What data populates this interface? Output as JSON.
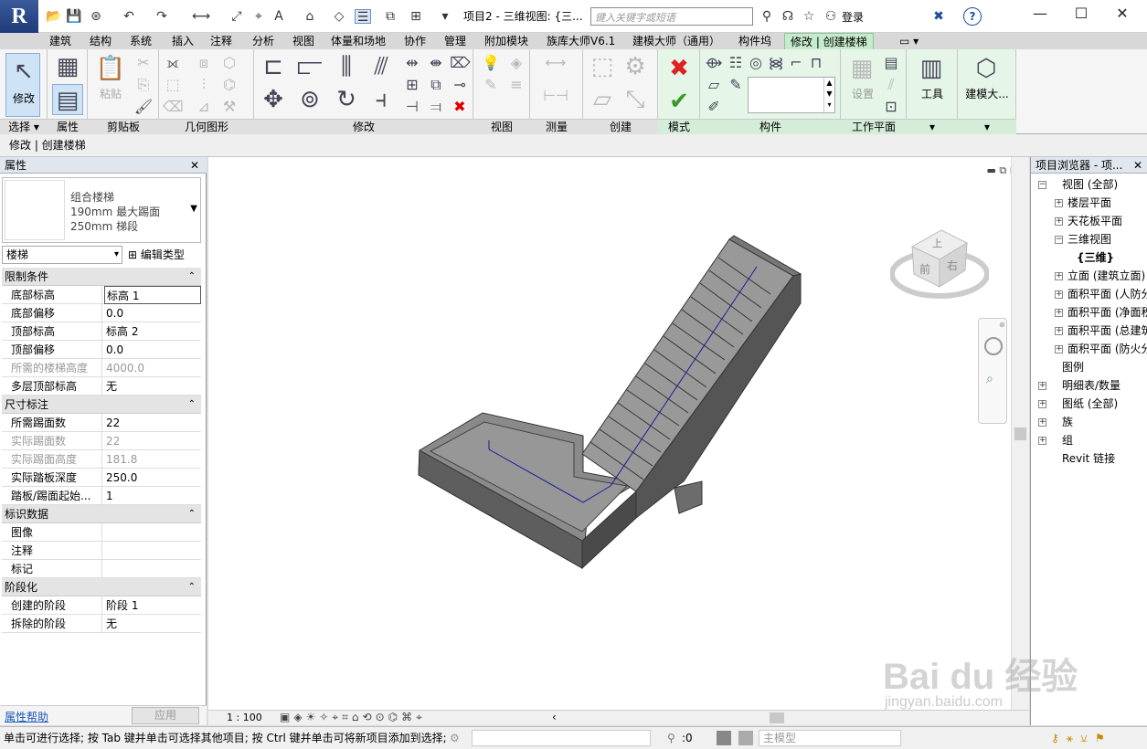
{
  "titlebar": {
    "logo": "R",
    "doc_title": "项目2 - 三维视图: {三...",
    "search_placeholder": "键入关键字或短语",
    "login": "登录",
    "help": "?",
    "min": "—",
    "max": "☐",
    "close": "✕"
  },
  "tabs": [
    "建筑",
    "结构",
    "系统",
    "插入",
    "注释",
    "分析",
    "视图",
    "体量和场地",
    "协作",
    "管理",
    "附加模块",
    "族库大师V6.1",
    "建模大师（通用）",
    "构件坞",
    "修改 | 创建楼梯"
  ],
  "ribbon": {
    "modify_label": "修改",
    "paste_label": "粘贴",
    "settings_label": "设置",
    "tools_label": "工具",
    "model_label": "建模大...",
    "panels": {
      "select": "选择 ▾",
      "properties": "属性",
      "clipboard": "剪贴板",
      "geometry": "几何图形",
      "modify": "修改",
      "view": "视图",
      "measure": "测量",
      "create": "创建",
      "mode": "模式",
      "component": "构件",
      "workplane": "工作平面"
    }
  },
  "context": "修改 | 创建楼梯",
  "properties": {
    "title": "属性",
    "type_line1": "组合楼梯",
    "type_line2": "190mm 最大踢面",
    "type_line3": "250mm 梯段",
    "filter": "楼梯",
    "edit_type": "编辑类型",
    "sections": [
      {
        "name": "限制条件",
        "rows": [
          {
            "k": "底部标高",
            "v": "标高 1",
            "dim": false
          },
          {
            "k": "底部偏移",
            "v": "0.0",
            "dim": false
          },
          {
            "k": "顶部标高",
            "v": "标高 2",
            "dim": false
          },
          {
            "k": "顶部偏移",
            "v": "0.0",
            "dim": false
          },
          {
            "k": "所需的楼梯高度",
            "v": "4000.0",
            "dim": true
          },
          {
            "k": "多层顶部标高",
            "v": "无",
            "dim": false
          }
        ]
      },
      {
        "name": "尺寸标注",
        "rows": [
          {
            "k": "所需踢面数",
            "v": "22",
            "dim": false
          },
          {
            "k": "实际踢面数",
            "v": "22",
            "dim": true
          },
          {
            "k": "实际踢面高度",
            "v": "181.8",
            "dim": true
          },
          {
            "k": "实际踏板深度",
            "v": "250.0",
            "dim": false
          },
          {
            "k": "踏板/踢面起始...",
            "v": "1",
            "dim": false
          }
        ]
      },
      {
        "name": "标识数据",
        "rows": [
          {
            "k": "图像",
            "v": "",
            "dim": false
          },
          {
            "k": "注释",
            "v": "",
            "dim": false
          },
          {
            "k": "标记",
            "v": "",
            "dim": false
          }
        ]
      },
      {
        "name": "阶段化",
        "rows": [
          {
            "k": "创建的阶段",
            "v": "阶段 1",
            "dim": false
          },
          {
            "k": "拆除的阶段",
            "v": "无",
            "dim": false
          }
        ]
      }
    ],
    "help_link": "属性帮助",
    "apply": "应用"
  },
  "viewcube": {
    "top": "上",
    "front": "前",
    "right": "右"
  },
  "view_scale": "1 : 100",
  "browser": {
    "title": "项目浏览器 - 项...",
    "items": [
      {
        "label": "视图 (全部)",
        "level": 0,
        "exp": "−"
      },
      {
        "label": "楼层平面",
        "level": 1,
        "exp": "+"
      },
      {
        "label": "天花板平面",
        "level": 1,
        "exp": "+"
      },
      {
        "label": "三维视图",
        "level": 1,
        "exp": "−"
      },
      {
        "label": "{三维}",
        "level": 2,
        "exp": ""
      },
      {
        "label": "立面 (建筑立面)",
        "level": 1,
        "exp": "+"
      },
      {
        "label": "面积平面 (人防分区面积)",
        "level": 1,
        "exp": "+"
      },
      {
        "label": "面积平面 (净面积)",
        "level": 1,
        "exp": "+"
      },
      {
        "label": "面积平面 (总建筑面积)",
        "level": 1,
        "exp": "+"
      },
      {
        "label": "面积平面 (防火分区面积)",
        "level": 1,
        "exp": "+"
      },
      {
        "label": "图例",
        "level": 0,
        "exp": ""
      },
      {
        "label": "明细表/数量",
        "level": 0,
        "exp": "+"
      },
      {
        "label": "图纸 (全部)",
        "level": 0,
        "exp": "+"
      },
      {
        "label": "族",
        "level": 0,
        "exp": "+"
      },
      {
        "label": "组",
        "level": 0,
        "exp": "+"
      },
      {
        "label": "Revit 链接",
        "level": 0,
        "exp": ""
      }
    ]
  },
  "status": {
    "message": "单击可进行选择; 按 Tab 键并单击可选择其他项目; 按 Ctrl 键并单击可将新项目添加到选择;",
    "count": ":0",
    "model": "主模型"
  },
  "watermark": {
    "main": "Bai du 经验",
    "sub": "jingyan.baidu.com"
  }
}
